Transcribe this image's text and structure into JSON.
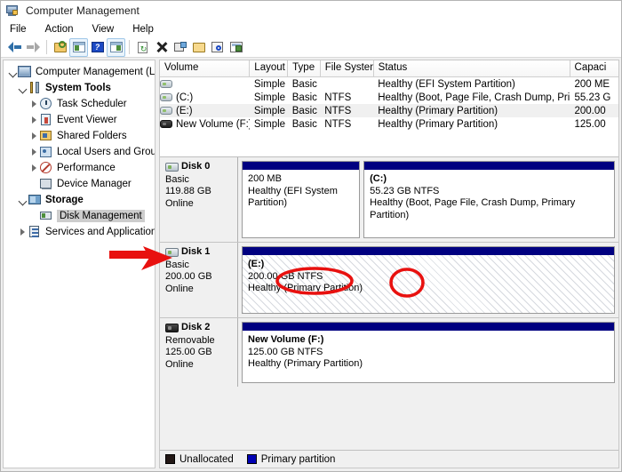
{
  "window": {
    "title": "Computer Management",
    "icon": "computer-management-icon"
  },
  "menu": {
    "items": [
      "File",
      "Action",
      "View",
      "Help"
    ]
  },
  "toolbar": {
    "buttons": [
      {
        "name": "back-button",
        "icon": "back-arrow-icon"
      },
      {
        "name": "forward-button",
        "icon": "forward-arrow-icon"
      },
      {
        "name": "up-folder-button",
        "icon": "folder-key-icon"
      },
      {
        "name": "show-hide-console-tree-button",
        "icon": "console-tree-icon"
      },
      {
        "name": "help-button",
        "icon": "help-icon"
      },
      {
        "name": "show-hide-action-pane-button",
        "icon": "action-pane-icon"
      },
      {
        "name": "refresh-button",
        "icon": "refresh-icon"
      },
      {
        "name": "delete-button",
        "icon": "delete-x-icon"
      },
      {
        "name": "properties-button",
        "icon": "properties-icon"
      },
      {
        "name": "open-button",
        "icon": "open-folder-icon"
      },
      {
        "name": "find-button",
        "icon": "magnifier-icon"
      },
      {
        "name": "export-list-button",
        "icon": "export-list-icon"
      }
    ]
  },
  "tree": {
    "root": {
      "label": "Computer Management (Local)",
      "icon": "computer-icon",
      "expanded": true
    },
    "items": [
      {
        "label": "System Tools",
        "icon": "system-tools-icon",
        "depth": 1,
        "expander": "open"
      },
      {
        "label": "Task Scheduler",
        "icon": "task-scheduler-icon",
        "depth": 2,
        "expander": "closed"
      },
      {
        "label": "Event Viewer",
        "icon": "event-viewer-icon",
        "depth": 2,
        "expander": "closed"
      },
      {
        "label": "Shared Folders",
        "icon": "shared-folders-icon",
        "depth": 2,
        "expander": "closed"
      },
      {
        "label": "Local Users and Groups",
        "icon": "local-users-icon",
        "depth": 2,
        "expander": "closed"
      },
      {
        "label": "Performance",
        "icon": "performance-icon",
        "depth": 2,
        "expander": "closed"
      },
      {
        "label": "Device Manager",
        "icon": "device-manager-icon",
        "depth": 2,
        "expander": "none"
      },
      {
        "label": "Storage",
        "icon": "storage-icon",
        "depth": 1,
        "expander": "open"
      },
      {
        "label": "Disk Management",
        "icon": "disk-management-icon",
        "depth": 2,
        "expander": "none",
        "selected": true
      },
      {
        "label": "Services and Applications",
        "icon": "services-icon",
        "depth": 1,
        "expander": "closed"
      }
    ]
  },
  "volume_list": {
    "columns": [
      "Volume",
      "Layout",
      "Type",
      "File System",
      "Status",
      "Capaci"
    ],
    "rows": [
      {
        "volume": "",
        "icon": "disk-volume-icon",
        "layout": "Simple",
        "type": "Basic",
        "file_system": "",
        "status": "Healthy (EFI System Partition)",
        "capacity": "200 ME",
        "selected": false
      },
      {
        "volume": "(C:)",
        "icon": "disk-volume-icon",
        "layout": "Simple",
        "type": "Basic",
        "file_system": "NTFS",
        "status": "Healthy (Boot, Page File, Crash Dump, Primary Partition)",
        "capacity": "55.23 G",
        "selected": false
      },
      {
        "volume": "(E:)",
        "icon": "disk-volume-icon",
        "layout": "Simple",
        "type": "Basic",
        "file_system": "NTFS",
        "status": "Healthy (Primary Partition)",
        "capacity": "200.00",
        "selected": true
      },
      {
        "volume": "New Volume (F:)",
        "icon": "removable-volume-icon",
        "layout": "Simple",
        "type": "Basic",
        "file_system": "NTFS",
        "status": "Healthy (Primary Partition)",
        "capacity": "125.00",
        "selected": false
      }
    ]
  },
  "disks": [
    {
      "name": "Disk 0",
      "icon": "fixed-disk-icon",
      "type": "Basic",
      "size": "119.88 GB",
      "state": "Online",
      "partitions": [
        {
          "title": "",
          "size": "200 MB",
          "status": "Healthy (EFI System Partition)",
          "width_pct": 32,
          "hatched": false
        },
        {
          "title": "(C:)",
          "size": "55.23 GB NTFS",
          "status": "Healthy (Boot, Page File, Crash Dump, Primary Partition)",
          "width_pct": 68,
          "hatched": false
        }
      ]
    },
    {
      "name": "Disk 1",
      "icon": "fixed-disk-icon",
      "type": "Basic",
      "size": "200.00 GB",
      "state": "Online",
      "partitions": [
        {
          "title": "(E:)",
          "size": "200.00 GB NTFS",
          "status": "Healthy (Primary Partition)",
          "width_pct": 100,
          "hatched": true
        }
      ]
    },
    {
      "name": "Disk 2",
      "icon": "removable-disk-icon",
      "type": "Removable",
      "size": "125.00 GB",
      "state": "Online",
      "partitions": [
        {
          "title": "New Volume  (F:)",
          "size": "125.00 GB NTFS",
          "status": "Healthy (Primary Partition)",
          "width_pct": 100,
          "hatched": false
        }
      ]
    }
  ],
  "legend": {
    "items": [
      {
        "label": "Unallocated",
        "color": "#231816"
      },
      {
        "label": "Primary partition",
        "color": "#0000b4"
      }
    ]
  },
  "annotations": {
    "arrow_color": "#e8110f",
    "circle_color": "#e8110f",
    "arrow": {
      "name": "red-pointer-arrow",
      "points_at": "Disk 0"
    },
    "circles": [
      {
        "name": "highlight-circle-system-partition",
        "target": "System Partition"
      },
      {
        "name": "highlight-circle-boot",
        "target": "(Boot,"
      }
    ]
  }
}
